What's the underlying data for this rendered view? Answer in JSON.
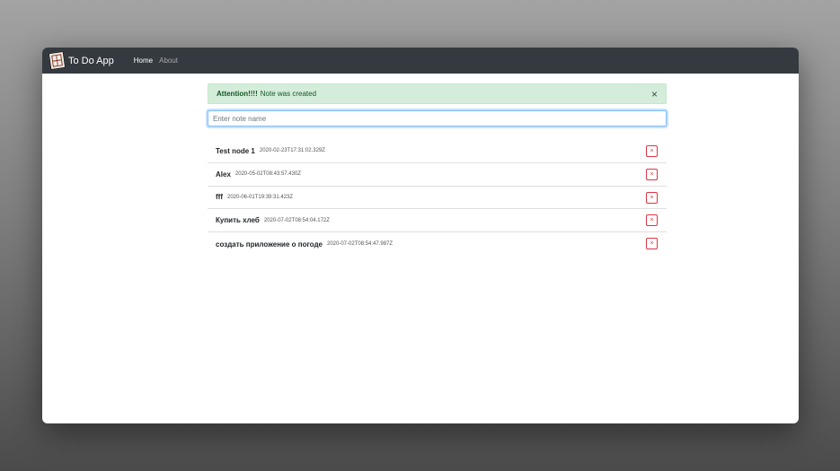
{
  "app": {
    "brand": "To Do App",
    "logo_icon": "window-logo-icon"
  },
  "nav": {
    "items": [
      {
        "label": "Home",
        "active": true
      },
      {
        "label": "About",
        "active": false
      }
    ]
  },
  "alert": {
    "strong": "Attention!!!!",
    "message": "Note was created",
    "close_symbol": "×",
    "colors": {
      "background": "#d4edda",
      "text": "#155724"
    }
  },
  "input": {
    "placeholder": "Enter note name",
    "value": ""
  },
  "notes": [
    {
      "title": "Test node 1",
      "date": "2020-02-23T17:31:02.329Z"
    },
    {
      "title": "Alex",
      "date": "2020-05-02T08:43:57.430Z"
    },
    {
      "title": "fff",
      "date": "2020-06-01T19:39:31.423Z"
    },
    {
      "title": "Купить хлеб",
      "date": "2020-07-02T08:54:04.172Z"
    },
    {
      "title": "создать приложение о погоде",
      "date": "2020-07-02T08:54:47.987Z"
    }
  ],
  "delete_symbol": "×",
  "colors": {
    "navbar": "#343a40",
    "delete_border": "#dc3545",
    "input_focus": "#80bdff"
  }
}
